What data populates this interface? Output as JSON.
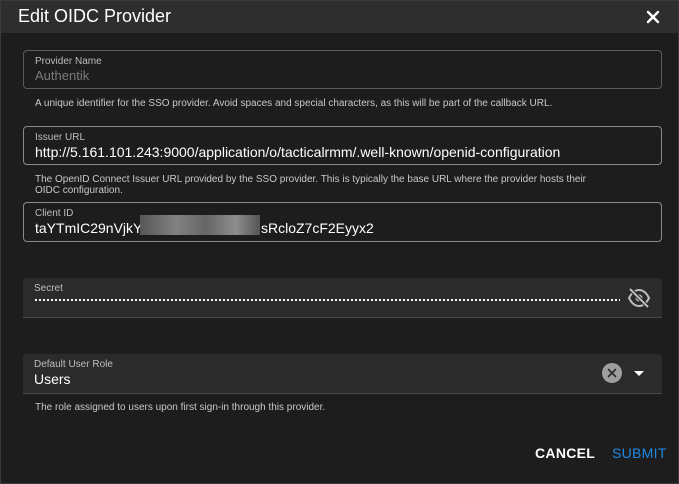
{
  "dialog": {
    "title": "Edit OIDC Provider"
  },
  "provider_name": {
    "label": "Provider Name",
    "value": "Authentik",
    "hint": "A unique identifier for the SSO provider. Avoid spaces and special characters, as this will be part of the callback URL."
  },
  "issuer_url": {
    "label": "Issuer URL",
    "value": "http://5.161.101.243:9000/application/o/tacticalrmm/.well-known/openid-configuration",
    "hint_line1": "The OpenID Connect Issuer URL provided by the SSO provider. This is typically the base URL where the provider hosts their",
    "hint_line2": "OIDC configuration."
  },
  "client_id": {
    "label": "Client ID",
    "value_start": "taYTmIC29nVjkY",
    "value_end": "sRcloZ7cF2Eyyx2"
  },
  "secret": {
    "label": "Secret"
  },
  "default_role": {
    "label": "Default User Role",
    "value": "Users",
    "hint": "The role assigned to users upon first sign-in through this provider."
  },
  "actions": {
    "cancel": "CANCEL",
    "submit": "SUBMIT"
  },
  "icons": {
    "close": "close-icon",
    "eye": "eye-off-icon",
    "clear": "clear-icon",
    "dropdown": "dropdown-arrow-icon"
  },
  "colors": {
    "accent": "#1e88e5",
    "background": "#1d1d1d",
    "title_bar": "#2e2e2e"
  }
}
